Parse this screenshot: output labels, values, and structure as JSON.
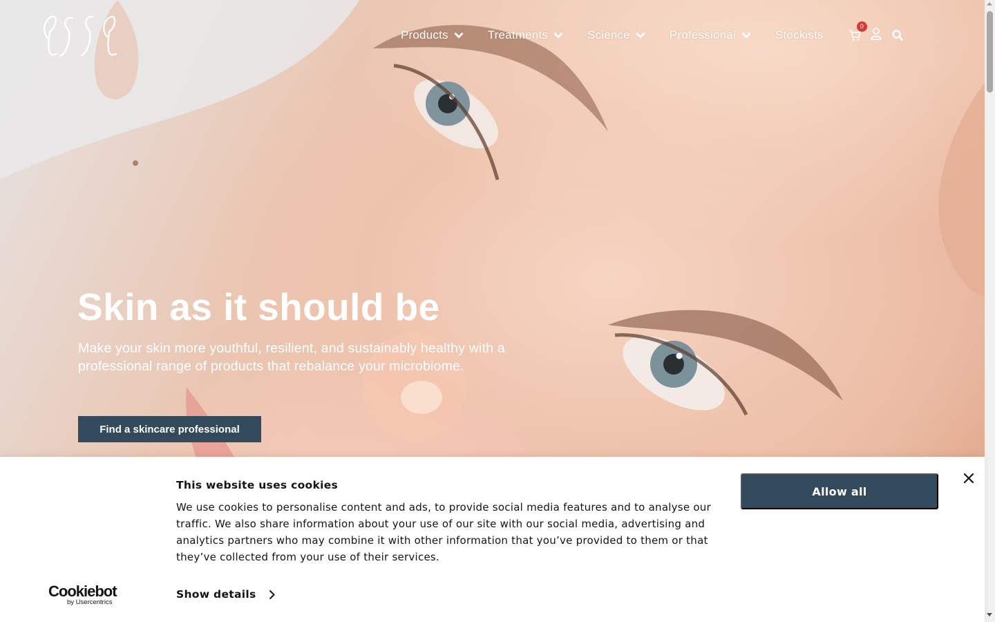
{
  "brand": {
    "logo_text": "esse"
  },
  "nav": {
    "items": [
      {
        "label": "Products",
        "has_dropdown": true
      },
      {
        "label": "Treatments",
        "has_dropdown": true
      },
      {
        "label": "Science",
        "has_dropdown": true
      },
      {
        "label": "Professional",
        "has_dropdown": true
      },
      {
        "label": "Stockists",
        "has_dropdown": false
      }
    ],
    "cart_count": "0",
    "icons": [
      "cart-icon",
      "user-icon",
      "search-icon"
    ]
  },
  "hero": {
    "headline": "Skin as it should be",
    "subline": "Make your skin more youthful, resilient, and sustainably healthy with a professional range of products that rebalance your microbiome.",
    "cta_label": "Find a skincare professional"
  },
  "cookie_banner": {
    "title": "This website uses cookies",
    "body": "We use cookies to personalise content and ads, to provide social media features and to analyse our traffic. We also share information about your use of our site with our social media, advertising and analytics partners who may combine it with other information that you’ve provided to them or that they’ve collected from your use of their services.",
    "show_details_label": "Show details",
    "allow_all_label": "Allow all",
    "provider_name": "Cookiebot",
    "provider_sub": "by Usercentrics"
  },
  "colors": {
    "primary_button": "#33495c",
    "badge": "#d63a3a",
    "text_dark": "#141414",
    "nav_text": "#ffffff"
  }
}
